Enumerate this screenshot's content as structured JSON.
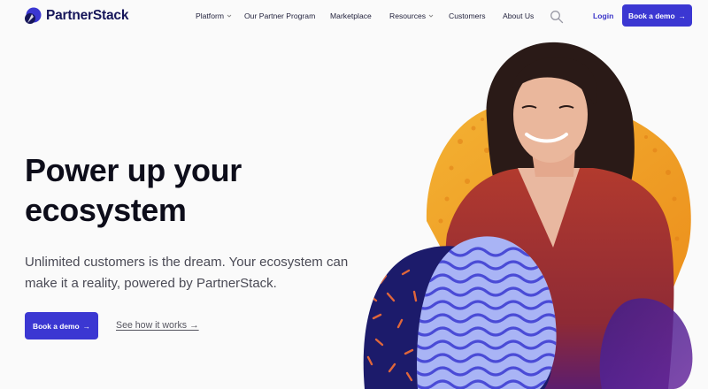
{
  "brand": {
    "name": "PartnerStack"
  },
  "nav": {
    "items": [
      {
        "label": "Platform",
        "has_dropdown": true
      },
      {
        "label": "Our Partner Program",
        "has_dropdown": false
      },
      {
        "label": "Marketplace",
        "has_dropdown": false
      },
      {
        "label": "Resources",
        "has_dropdown": true
      },
      {
        "label": "Customers",
        "has_dropdown": false
      },
      {
        "label": "About Us",
        "has_dropdown": false
      }
    ],
    "search_icon": "search-icon",
    "login_label": "Login",
    "cta_label": "Book a demo",
    "cta_arrow": "→"
  },
  "hero": {
    "headline_line1": "Power up your",
    "headline_line2": "ecosystem",
    "subheadline": "Unlimited customers is the dream. Your ecosystem can make it a reality, powered by PartnerStack.",
    "primary_cta": "Book a demo",
    "primary_cta_arrow": "→",
    "secondary_cta": "See how it works →"
  },
  "colors": {
    "brand_primary": "#3b37d2",
    "brand_navy": "#16165a",
    "blob_orange": "#f0a322",
    "blob_navy": "#1c1b6b",
    "wave_lavender": "#a9b4f5",
    "shirt_red": "#a8322a"
  }
}
